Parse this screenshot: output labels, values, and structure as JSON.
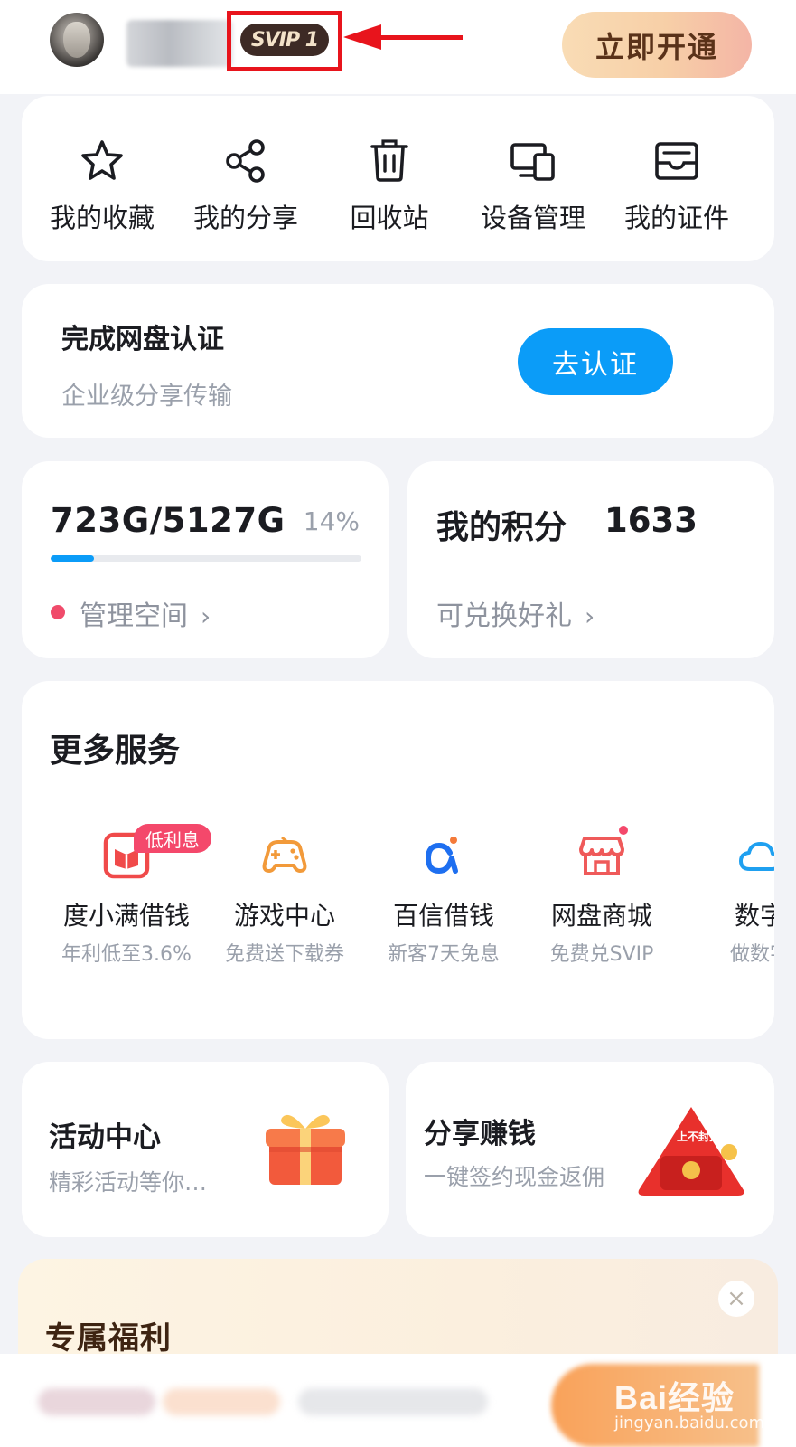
{
  "header": {
    "vip_badge": "SVIP 1",
    "open_button": "立即开通"
  },
  "tools": [
    {
      "label": "我的收藏",
      "icon": "star-icon"
    },
    {
      "label": "我的分享",
      "icon": "share-icon"
    },
    {
      "label": "回收站",
      "icon": "trash-icon"
    },
    {
      "label": "设备管理",
      "icon": "devices-icon"
    },
    {
      "label": "我的证件",
      "icon": "id-card-icon"
    }
  ],
  "auth": {
    "title": "完成网盘认证",
    "subtitle": "企业级分享传输",
    "button": "去认证"
  },
  "storage": {
    "value": "723G/5127G",
    "percent_text": "14%",
    "progress": 0.14,
    "link": "管理空间"
  },
  "points": {
    "label": "我的积分",
    "value": "1633",
    "link": "可兑换好礼"
  },
  "services": {
    "title": "更多服务",
    "badge": "低利息",
    "items": [
      {
        "name": "度小满借钱",
        "desc": "年利低至3.6%",
        "icon": "loan-book-icon",
        "color": "#f04a4a"
      },
      {
        "name": "游戏中心",
        "desc": "免费送下载券",
        "icon": "gamepad-icon",
        "color": "#f29a3a"
      },
      {
        "name": "百信借钱",
        "desc": "新客7天免息",
        "icon": "alpha-icon",
        "color": "#1e6ff0"
      },
      {
        "name": "网盘商城",
        "desc": "免费兑SVIP",
        "icon": "store-icon",
        "color": "#ef5a5a"
      },
      {
        "name": "数字",
        "desc": "做数字",
        "icon": "cloud-icon",
        "color": "#1fa0f0"
      }
    ]
  },
  "activity": {
    "title": "活动中心",
    "subtitle": "精彩活动等你…"
  },
  "share_earn": {
    "title": "分享赚钱",
    "subtitle": "一键签约现金返佣",
    "tag": "上不封顶"
  },
  "welfare": {
    "title": "专属福利",
    "close": "×"
  },
  "watermark": {
    "text": "Bai经验",
    "sub": "jingyan.baidu.com"
  },
  "colors": {
    "accent_blue": "#0b9cf8",
    "highlight_red": "#e8141c",
    "pink_dot": "#f04b6b"
  }
}
